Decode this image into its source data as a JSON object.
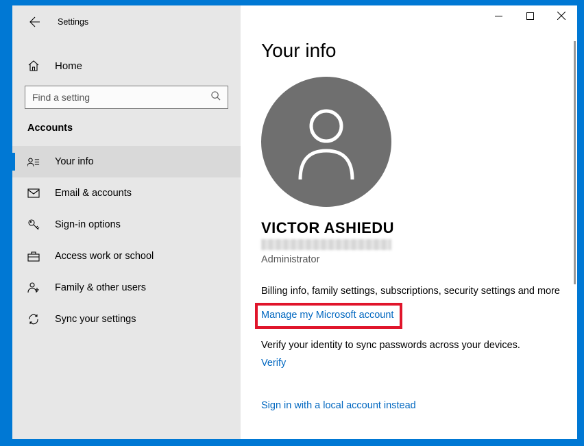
{
  "window": {
    "title": "Settings"
  },
  "sidebar": {
    "home_label": "Home",
    "search_placeholder": "Find a setting",
    "category": "Accounts",
    "items": [
      {
        "icon": "user-info-icon",
        "label": "Your info",
        "active": true
      },
      {
        "icon": "email-icon",
        "label": "Email & accounts",
        "active": false
      },
      {
        "icon": "key-icon",
        "label": "Sign-in options",
        "active": false
      },
      {
        "icon": "briefcase-icon",
        "label": "Access work or school",
        "active": false
      },
      {
        "icon": "family-icon",
        "label": "Family & other users",
        "active": false
      },
      {
        "icon": "sync-icon",
        "label": "Sync your settings",
        "active": false
      }
    ]
  },
  "content": {
    "page_title": "Your info",
    "user_name": "VICTOR ASHIEDU",
    "role": "Administrator",
    "billing_desc": "Billing info, family settings, subscriptions, security settings and more",
    "manage_link": "Manage my Microsoft account",
    "verify_desc": "Verify your identity to sync passwords across your devices.",
    "verify_link": "Verify",
    "local_account_link": "Sign in with a local account instead"
  }
}
